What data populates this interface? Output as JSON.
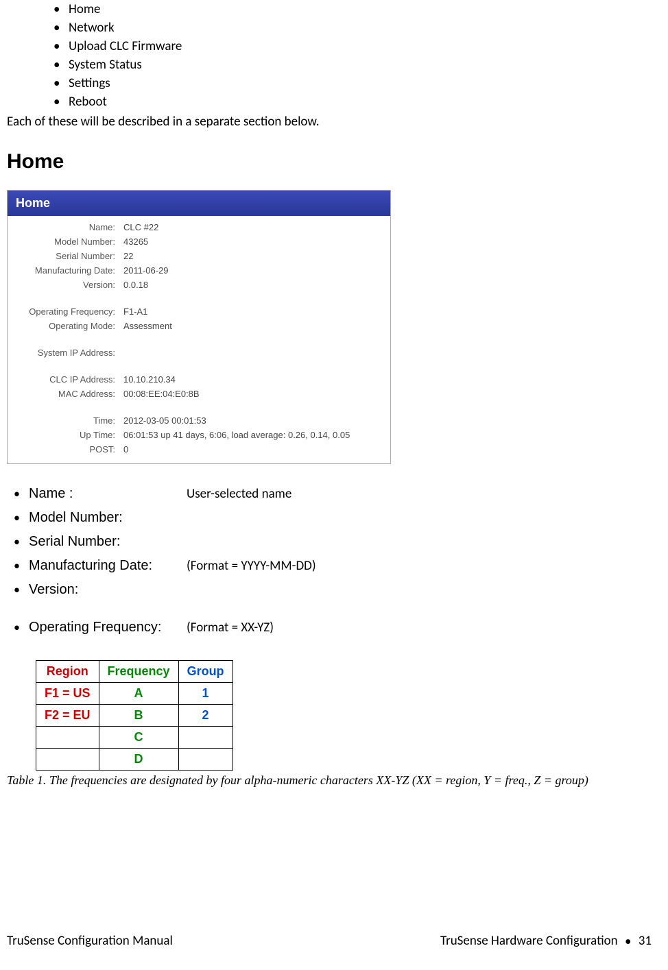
{
  "nav_items": [
    "Home",
    "Network",
    "Upload CLC Firmware",
    "System Status",
    "Settings",
    "Reboot"
  ],
  "intro_para": "Each of these will be described in a separate section below.",
  "section_heading": "Home",
  "home_card": {
    "title": "Home",
    "rows": [
      {
        "label": "Name:",
        "value": "CLC #22"
      },
      {
        "label": "Model Number:",
        "value": "43265"
      },
      {
        "label": "Serial Number:",
        "value": "22"
      },
      {
        "label": "Manufacturing Date:",
        "value": "2011-06-29"
      },
      {
        "label": "Version:",
        "value": "0.0.18"
      }
    ],
    "rows2": [
      {
        "label": "Operating Frequency:",
        "value": "F1-A1"
      },
      {
        "label": "Operating Mode:",
        "value": "Assessment"
      }
    ],
    "rows3": [
      {
        "label": "System IP Address:",
        "value": ""
      }
    ],
    "rows4": [
      {
        "label": "CLC IP Address:",
        "value": "10.10.210.34"
      },
      {
        "label": "MAC Address:",
        "value": "00:08:EE:04:E0:8B"
      }
    ],
    "rows5": [
      {
        "label": "Time:",
        "value": "2012-03-05 00:01:53"
      },
      {
        "label": "Up Time:",
        "value": "06:01:53 up 41 days, 6:06, load average: 0.26, 0.14, 0.05"
      },
      {
        "label": "POST:",
        "value": "0"
      }
    ]
  },
  "field_definitions": [
    {
      "label": "Name :",
      "desc": "User-selected name"
    },
    {
      "label": "Model Number:",
      "desc": ""
    },
    {
      "label": "Serial Number:",
      "desc": ""
    },
    {
      "label": "Manufacturing Date:",
      "desc": "(Format = YYYY-MM-DD)"
    },
    {
      "label": "Version:",
      "desc": ""
    }
  ],
  "field_definitions2": [
    {
      "label": "Operating Frequency:",
      "desc": "(Format = XX-YZ)"
    }
  ],
  "freq_table": {
    "headers": {
      "region": "Region",
      "frequency": "Frequency",
      "group": "Group"
    },
    "rows": [
      {
        "region": "F1 = US",
        "frequency": "A",
        "group": "1"
      },
      {
        "region": "F2 = EU",
        "frequency": "B",
        "group": "2"
      },
      {
        "region": "",
        "frequency": "C",
        "group": ""
      },
      {
        "region": "",
        "frequency": "D",
        "group": ""
      }
    ]
  },
  "table_caption": "Table 1.  The frequencies are designated by four alpha-numeric characters XX-YZ (XX = region, Y = freq., Z = group)",
  "footer": {
    "left": "TruSense Configuration Manual",
    "right_section": "TruSense Hardware Configuration",
    "right_page": "31"
  }
}
